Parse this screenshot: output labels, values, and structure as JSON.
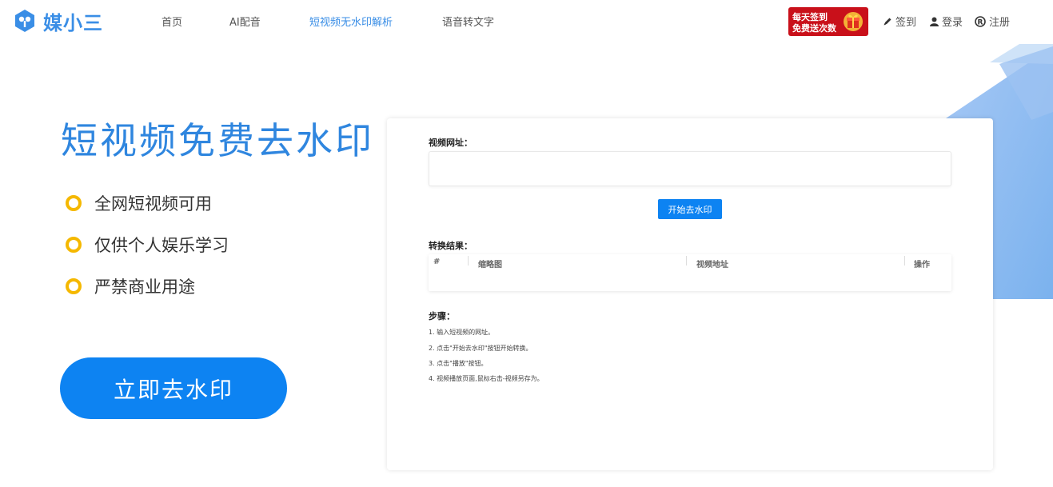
{
  "brand": {
    "name": "媒小三"
  },
  "nav": [
    {
      "label": "首页",
      "active": false
    },
    {
      "label": "AI配音",
      "active": false
    },
    {
      "label": "短视频无水印解析",
      "active": true
    },
    {
      "label": "语音转文字",
      "active": false
    }
  ],
  "promo": {
    "line1": "每天签到",
    "line2": "免费送次数"
  },
  "top_links": {
    "checkin": "签到",
    "login": "登录",
    "register": "注册"
  },
  "hero": {
    "title": "短视频免费去水印",
    "features": [
      "全网短视频可用",
      "仅供个人娱乐学习",
      "严禁商业用途"
    ],
    "cta": "立即去水印"
  },
  "panel": {
    "url_label": "视频网址：",
    "url_value": "",
    "start_button": "开始去水印",
    "result_label": "转换结果：",
    "table_headers": [
      "#",
      "缩略图",
      "视频地址",
      "操作"
    ],
    "steps_label": "步骤：",
    "steps": [
      "1. 输入短视频的网址。",
      "2. 点击\"开始去水印\"按钮开始转换。",
      "3. 点击\"播放\"按钮。",
      "4. 视频播放页面,鼠标右击-视频另存为。"
    ]
  },
  "colors": {
    "accent": "#0d83f2",
    "brand_blue": "#3a8ee6",
    "ring": "#f5b800",
    "promo_red": "#c9101a"
  }
}
